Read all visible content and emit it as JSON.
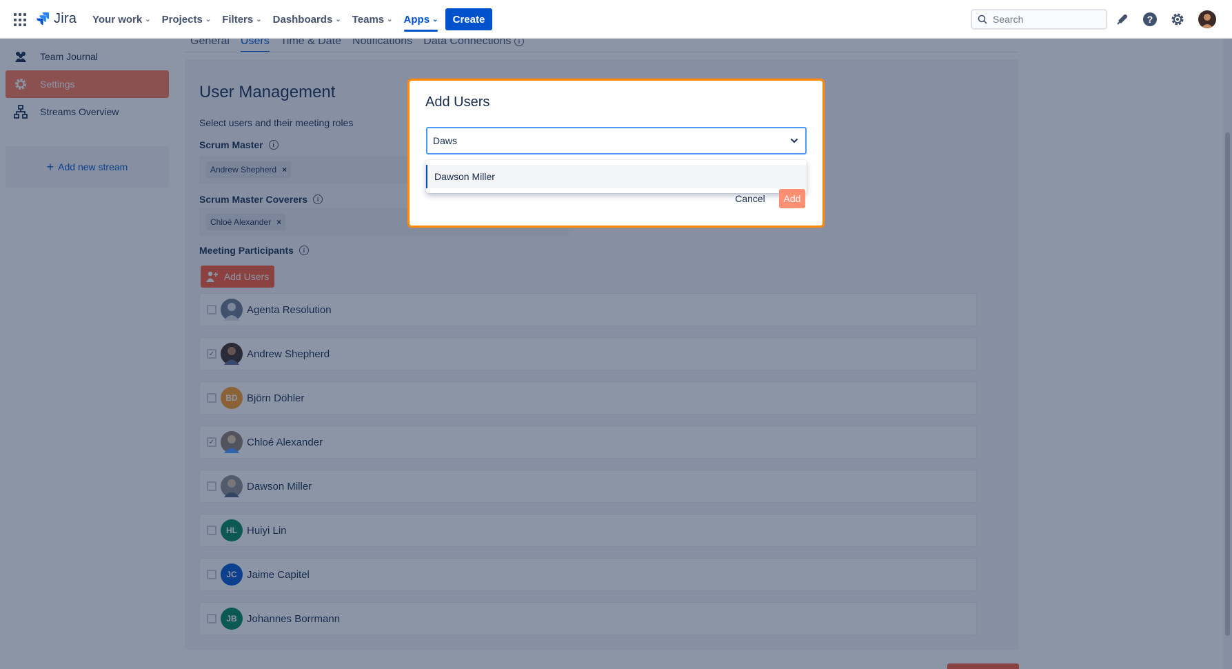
{
  "app": {
    "logo_text": "Jira"
  },
  "nav": {
    "items": [
      {
        "label": "Your work",
        "active": false
      },
      {
        "label": "Projects",
        "active": false
      },
      {
        "label": "Filters",
        "active": false
      },
      {
        "label": "Dashboards",
        "active": false
      },
      {
        "label": "Teams",
        "active": false
      },
      {
        "label": "Apps",
        "active": true
      }
    ],
    "create_label": "Create",
    "search_placeholder": "Search"
  },
  "sidebar": {
    "items": [
      {
        "label": "Team Journal",
        "icon": "people-icon",
        "selected": false
      },
      {
        "label": "Settings",
        "icon": "gear-icon",
        "selected": true
      },
      {
        "label": "Streams Overview",
        "icon": "hierarchy-icon",
        "selected": false
      }
    ],
    "add_stream_label": "Add new stream"
  },
  "tabs": [
    {
      "label": "General",
      "active": false
    },
    {
      "label": "Users",
      "active": true
    },
    {
      "label": "Time & Date",
      "active": false
    },
    {
      "label": "Notifications",
      "active": false
    },
    {
      "label": "Data Connections",
      "active": false
    }
  ],
  "user_management": {
    "title": "User Management",
    "subtitle": "Select users and their meeting roles",
    "scrum_master_label": "Scrum Master",
    "scrum_master_value": "Andrew Shepherd",
    "coverers_label": "Scrum Master Coverers",
    "coverers_value": "Chloé Alexander",
    "participants_label": "Meeting Participants",
    "add_users_label": "Add Users",
    "users": [
      {
        "name": "Agenta Resolution",
        "checked": false,
        "initials": "",
        "color": "#6b778c"
      },
      {
        "name": "Andrew Shepherd",
        "checked": true,
        "initials": "",
        "color": "#3b2a25"
      },
      {
        "name": "Björn Döhler",
        "checked": false,
        "initials": "BD",
        "color": "#ff991f"
      },
      {
        "name": "Chloé Alexander",
        "checked": true,
        "initials": "",
        "color": "#8c7b6b"
      },
      {
        "name": "Dawson Miller",
        "checked": false,
        "initials": "",
        "color": "#8a8a8a"
      },
      {
        "name": "Huiyi Lin",
        "checked": false,
        "initials": "HL",
        "color": "#00875a"
      },
      {
        "name": "Jaime Capitel",
        "checked": false,
        "initials": "JC",
        "color": "#0052cc"
      },
      {
        "name": "Johannes Borrmann",
        "checked": false,
        "initials": "JB",
        "color": "#00875a"
      }
    ]
  },
  "modal": {
    "title": "Add Users",
    "input_value": "Daws",
    "options": [
      "Dawson Miller"
    ],
    "cancel_label": "Cancel",
    "add_label": "Add"
  },
  "colors": {
    "brand": "#0052cc",
    "accent": "#ff5630",
    "focus_ring": "#ff8b00"
  }
}
